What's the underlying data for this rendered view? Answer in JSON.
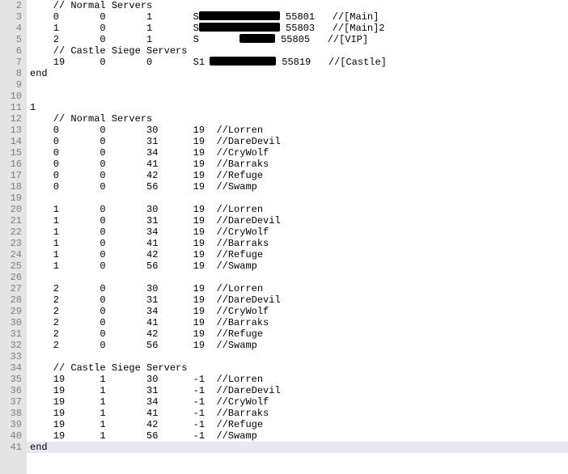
{
  "startLine": 2,
  "lines": [
    {
      "type": "comment",
      "indent": "    ",
      "text": "// Normal Servers"
    },
    {
      "type": "server",
      "c1": "0",
      "c2": "0",
      "c3": "1",
      "c4": "S",
      "redact": "r1",
      "port": "55801",
      "label": "//[Main]"
    },
    {
      "type": "server",
      "c1": "1",
      "c2": "0",
      "c3": "1",
      "c4": "S",
      "redact": "r2",
      "port": "55803",
      "label": "//[Main]2"
    },
    {
      "type": "server",
      "c1": "2",
      "c2": "0",
      "c3": "1",
      "c4": "S",
      "redact": "r3",
      "port": "55805",
      "label": "//[VIP]"
    },
    {
      "type": "comment",
      "indent": "    ",
      "text": "// Castle Siege Servers"
    },
    {
      "type": "server",
      "c1": "19",
      "c2": "0",
      "c3": "0",
      "c4": "S1",
      "redact": "r4",
      "port": "55819",
      "label": "//[Castle]"
    },
    {
      "type": "plain",
      "text": "end"
    },
    {
      "type": "blank"
    },
    {
      "type": "blank"
    },
    {
      "type": "plain",
      "text": "1"
    },
    {
      "type": "comment",
      "indent": "    ",
      "text": "// Normal Servers"
    },
    {
      "type": "map",
      "c1": "0",
      "c2": "0",
      "c3": "30",
      "c4": "19",
      "label": "//Lorren"
    },
    {
      "type": "map",
      "c1": "0",
      "c2": "0",
      "c3": "31",
      "c4": "19",
      "label": "//DareDevil"
    },
    {
      "type": "map",
      "c1": "0",
      "c2": "0",
      "c3": "34",
      "c4": "19",
      "label": "//CryWolf"
    },
    {
      "type": "map",
      "c1": "0",
      "c2": "0",
      "c3": "41",
      "c4": "19",
      "label": "//Barraks"
    },
    {
      "type": "map",
      "c1": "0",
      "c2": "0",
      "c3": "42",
      "c4": "19",
      "label": "//Refuge"
    },
    {
      "type": "map",
      "c1": "0",
      "c2": "0",
      "c3": "56",
      "c4": "19",
      "label": "//Swamp"
    },
    {
      "type": "blank"
    },
    {
      "type": "map",
      "c1": "1",
      "c2": "0",
      "c3": "30",
      "c4": "19",
      "label": "//Lorren"
    },
    {
      "type": "map",
      "c1": "1",
      "c2": "0",
      "c3": "31",
      "c4": "19",
      "label": "//DareDevil"
    },
    {
      "type": "map",
      "c1": "1",
      "c2": "0",
      "c3": "34",
      "c4": "19",
      "label": "//CryWolf"
    },
    {
      "type": "map",
      "c1": "1",
      "c2": "0",
      "c3": "41",
      "c4": "19",
      "label": "//Barraks"
    },
    {
      "type": "map",
      "c1": "1",
      "c2": "0",
      "c3": "42",
      "c4": "19",
      "label": "//Refuge"
    },
    {
      "type": "map",
      "c1": "1",
      "c2": "0",
      "c3": "56",
      "c4": "19",
      "label": "//Swamp"
    },
    {
      "type": "blank"
    },
    {
      "type": "map",
      "c1": "2",
      "c2": "0",
      "c3": "30",
      "c4": "19",
      "label": "//Lorren"
    },
    {
      "type": "map",
      "c1": "2",
      "c2": "0",
      "c3": "31",
      "c4": "19",
      "label": "//DareDevil"
    },
    {
      "type": "map",
      "c1": "2",
      "c2": "0",
      "c3": "34",
      "c4": "19",
      "label": "//CryWolf"
    },
    {
      "type": "map",
      "c1": "2",
      "c2": "0",
      "c3": "41",
      "c4": "19",
      "label": "//Barraks"
    },
    {
      "type": "map",
      "c1": "2",
      "c2": "0",
      "c3": "42",
      "c4": "19",
      "label": "//Refuge"
    },
    {
      "type": "map",
      "c1": "2",
      "c2": "0",
      "c3": "56",
      "c4": "19",
      "label": "//Swamp"
    },
    {
      "type": "blank"
    },
    {
      "type": "comment",
      "indent": "    ",
      "text": "// Castle Siege Servers"
    },
    {
      "type": "map",
      "c1": "19",
      "c2": "1",
      "c3": "30",
      "c4": "-1",
      "label": "//Lorren"
    },
    {
      "type": "map",
      "c1": "19",
      "c2": "1",
      "c3": "31",
      "c4": "-1",
      "label": "//DareDevil"
    },
    {
      "type": "map",
      "c1": "19",
      "c2": "1",
      "c3": "34",
      "c4": "-1",
      "label": "//CryWolf"
    },
    {
      "type": "map",
      "c1": "19",
      "c2": "1",
      "c3": "41",
      "c4": "-1",
      "label": "//Barraks"
    },
    {
      "type": "map",
      "c1": "19",
      "c2": "1",
      "c3": "42",
      "c4": "-1",
      "label": "//Refuge"
    },
    {
      "type": "map",
      "c1": "19",
      "c2": "1",
      "c3": "56",
      "c4": "-1",
      "label": "//Swamp"
    },
    {
      "type": "end",
      "text": "end"
    }
  ]
}
